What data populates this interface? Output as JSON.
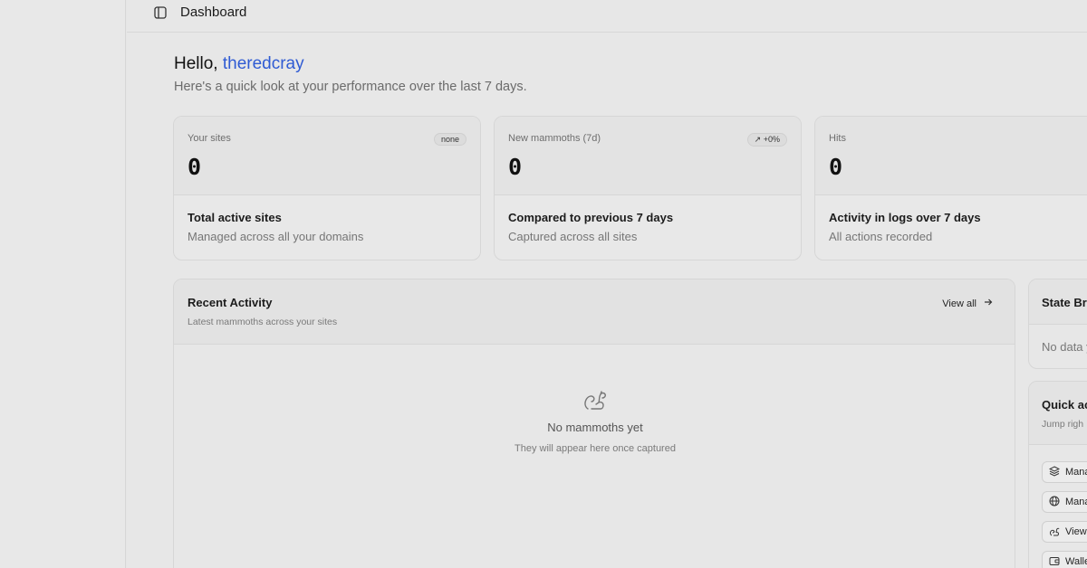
{
  "topbar": {
    "title": "Dashboard"
  },
  "header": {
    "greeting_prefix": "Hello, ",
    "username": "theredcray",
    "subtitle": "Here's a quick look at your performance over the last 7 days."
  },
  "cards": [
    {
      "label": "Your sites",
      "badge": "none",
      "value": "0",
      "foot_title": "Total active sites",
      "foot_sub": "Managed across all your domains"
    },
    {
      "label": "New mammoths (7d)",
      "badge": "+0%",
      "value": "0",
      "foot_title": "Compared to previous 7 days",
      "foot_sub": "Captured across all sites"
    },
    {
      "label": "Hits",
      "badge": "+",
      "value": "0",
      "foot_title": "Activity in logs over 7 days",
      "foot_sub": "All actions recorded"
    }
  ],
  "activity": {
    "title": "Recent Activity",
    "subtitle": "Latest mammoths across your sites",
    "view_all": "View all",
    "empty_title": "No mammoths yet",
    "empty_sub": "They will appear here once captured"
  },
  "state_breakdown": {
    "title": "State Bre",
    "empty": "No data y"
  },
  "quick_actions": {
    "title": "Quick ac",
    "subtitle": "Jump righ",
    "items": [
      {
        "label": "Mana",
        "icon": "layers-icon"
      },
      {
        "label": "Mana",
        "icon": "globe-icon"
      },
      {
        "label": "View",
        "icon": "squirrel-icon"
      },
      {
        "label": "Walle",
        "icon": "wallet-icon"
      }
    ]
  }
}
